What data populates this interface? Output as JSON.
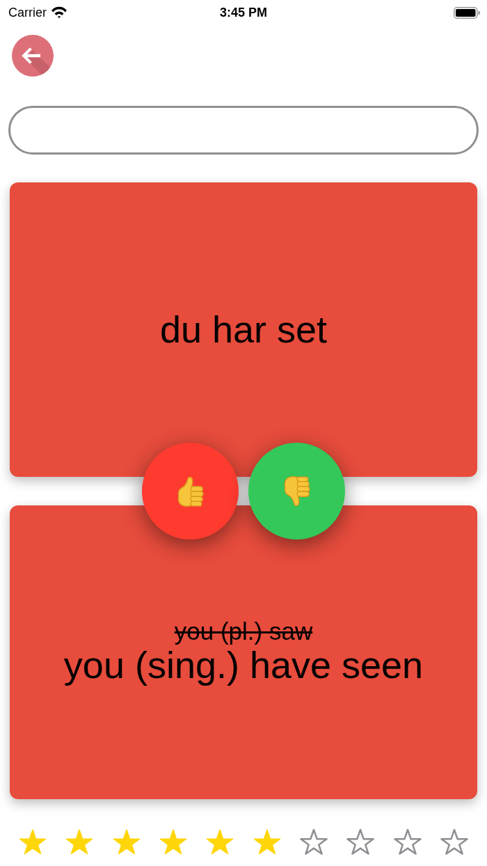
{
  "status_bar": {
    "carrier": "Carrier",
    "time": "3:45 PM"
  },
  "prompt_card": {
    "text": "du har set"
  },
  "vote_buttons": [
    {
      "kind": "thumbs_up",
      "color": "#ff3b30"
    },
    {
      "kind": "thumbs_down",
      "color": "#34c759"
    }
  ],
  "answer_card": {
    "lines": [
      {
        "text": "you (pl.) saw",
        "struck": true
      },
      {
        "text": "you (sing.) have seen",
        "struck": false
      }
    ]
  },
  "rating": {
    "stars": 6
  }
}
